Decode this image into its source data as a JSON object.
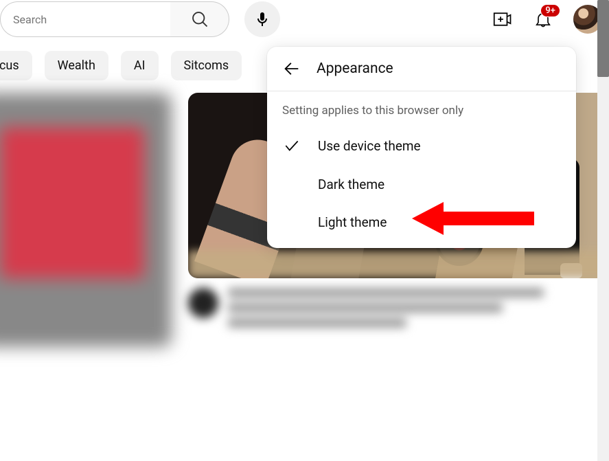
{
  "header": {
    "search_placeholder": "Search",
    "notification_badge": "9+"
  },
  "chips": [
    "cus",
    "Wealth",
    "AI",
    "Sitcoms"
  ],
  "menu": {
    "title": "Appearance",
    "subtitle": "Setting applies to this browser only",
    "items": [
      {
        "label": "Use device theme",
        "selected": true
      },
      {
        "label": "Dark theme",
        "selected": false
      },
      {
        "label": "Light theme",
        "selected": false
      }
    ]
  }
}
